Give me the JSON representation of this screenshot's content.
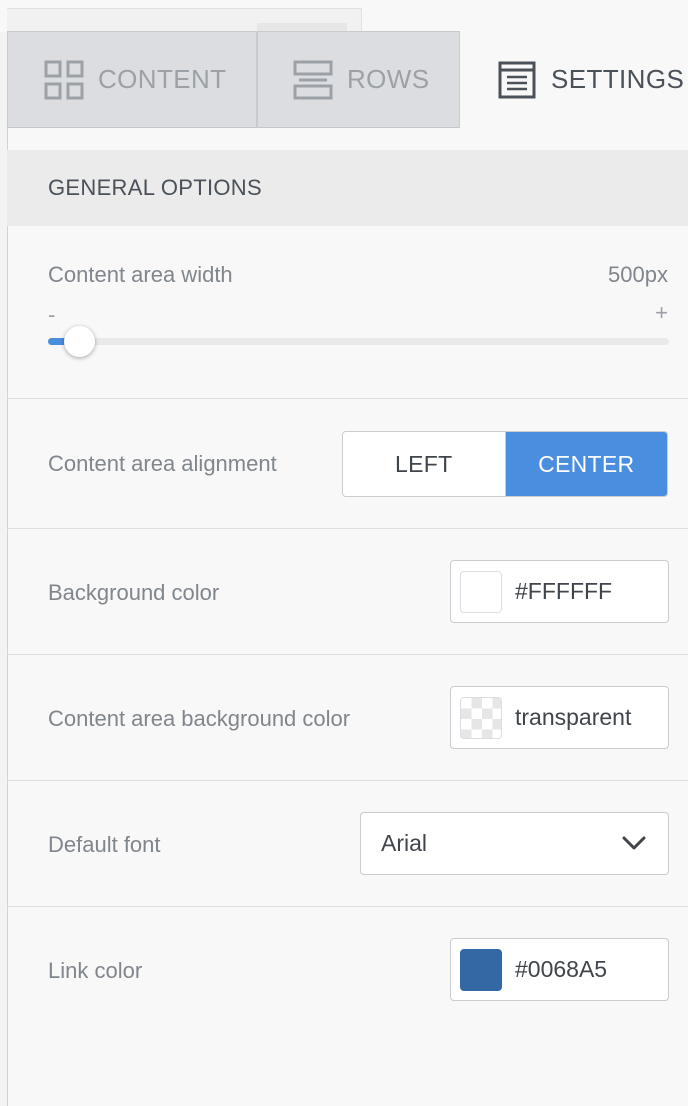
{
  "tabs": [
    {
      "label": "CONTENT",
      "icon": "grid-icon",
      "active": false
    },
    {
      "label": "ROWS",
      "icon": "rows-icon",
      "active": false
    },
    {
      "label": "SETTINGS",
      "icon": "settings-document-icon",
      "active": true
    }
  ],
  "section": {
    "title": "GENERAL OPTIONS"
  },
  "content_width": {
    "label": "Content area width",
    "value_text": "500px",
    "minus": "-",
    "plus": "+",
    "slider_fraction": 0.05
  },
  "alignment": {
    "label": "Content area alignment",
    "options": [
      "LEFT",
      "CENTER"
    ],
    "selected": "CENTER"
  },
  "background_color": {
    "label": "Background color",
    "value": "#FFFFFF",
    "swatch": "#FFFFFF"
  },
  "content_bg_color": {
    "label": "Content area background color",
    "value": "transparent",
    "swatch": "checkerboard"
  },
  "default_font": {
    "label": "Default font",
    "value": "Arial",
    "icon": "chevron-down-icon"
  },
  "link_color": {
    "label": "Link color",
    "value": "#0068A5",
    "swatch": "#3468A4"
  },
  "colors": {
    "accent": "#4A8EE0",
    "header_bg": "#EBEBEB",
    "inactive_tab_bg": "#DCDDE0"
  }
}
